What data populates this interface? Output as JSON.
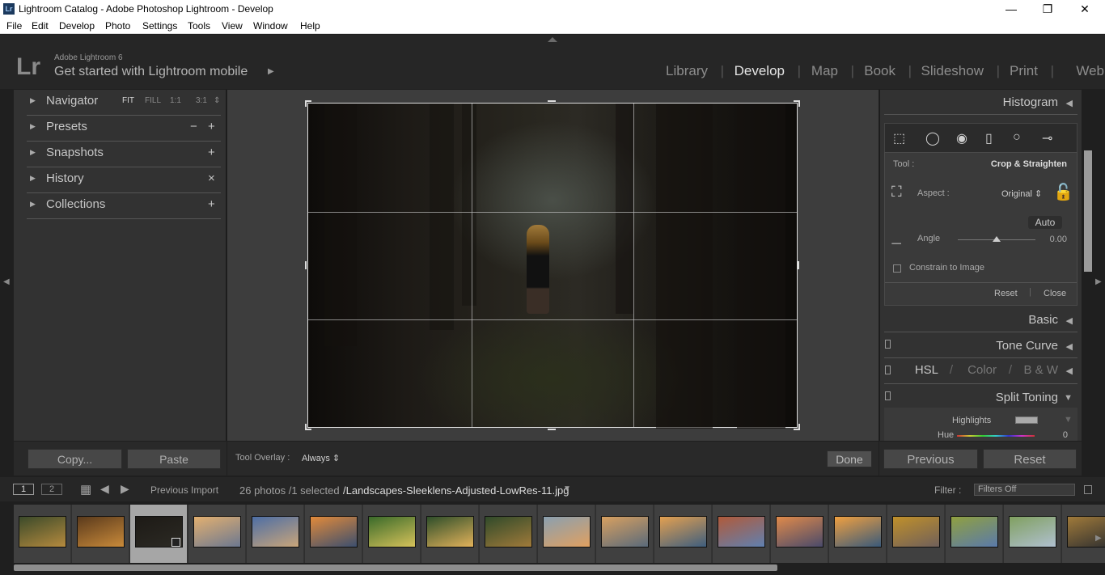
{
  "window": {
    "title": "Lightroom Catalog - Adobe Photoshop Lightroom - Develop",
    "app_icon": "Lr"
  },
  "menu": [
    "File",
    "Edit",
    "Develop",
    "Photo",
    "Settings",
    "Tools",
    "View",
    "Window",
    "Help"
  ],
  "identity": {
    "logo": "Lr",
    "small": "Adobe Lightroom 6",
    "big": "Get started with Lightroom mobile",
    "arrow": "▶"
  },
  "modules": [
    {
      "label": "Library",
      "active": false
    },
    {
      "label": "Develop",
      "active": true
    },
    {
      "label": "Map",
      "active": false
    },
    {
      "label": "Book",
      "active": false
    },
    {
      "label": "Slideshow",
      "active": false
    },
    {
      "label": "Print",
      "active": false
    },
    {
      "label": "Web",
      "active": false
    }
  ],
  "left_panel": {
    "navigator": {
      "label": "Navigator",
      "options": [
        "FIT",
        "FILL",
        "1:1",
        "3:1"
      ],
      "more": "⇕"
    },
    "presets": {
      "label": "Presets",
      "minus": "−",
      "plus": "+"
    },
    "snapshots": {
      "label": "Snapshots",
      "plus": "+"
    },
    "history": {
      "label": "History",
      "clear": "×"
    },
    "collections": {
      "label": "Collections",
      "plus": "+"
    }
  },
  "left_buttons": {
    "copy": "Copy...",
    "paste": "Paste"
  },
  "toolbar": {
    "overlay_label": "Tool Overlay :",
    "overlay_value": "Always ⇕",
    "done": "Done"
  },
  "right_panel": {
    "histogram": "Histogram",
    "tool_label": "Tool :",
    "tool_value": "Crop & Straighten",
    "aspect_label": "Aspect :",
    "aspect_value": "Original ⇕",
    "auto": "Auto",
    "angle_label": "Angle",
    "angle_value": "0.00",
    "constrain": "Constrain to Image",
    "reset": "Reset",
    "close": "Close",
    "basic": "Basic",
    "tone_curve": "Tone Curve",
    "hsl": "HSL",
    "color": "Color",
    "bw": "B & W",
    "split_toning": "Split Toning",
    "highlights": "Highlights",
    "hue": "Hue",
    "hue_value": "0",
    "collapsed_arrow": "◀",
    "expanded_arrow": "▼"
  },
  "right_buttons": {
    "previous": "Previous",
    "reset": "Reset"
  },
  "filmbar": {
    "page1": "1",
    "page2": "2",
    "source": "Previous Import",
    "count": "26 photos /1 selected",
    "filename": "/Landscapes-Sleeklens-Adjusted-LowRes-11.jpg",
    "filter_label": "Filter :",
    "filter_value": "Filters Off"
  },
  "thumbnails": [
    {
      "colors": [
        "#3b4a2a",
        "#b58a3e"
      ]
    },
    {
      "colors": [
        "#5a3a1c",
        "#c98a3a"
      ]
    },
    {
      "colors": [
        "#1d1a16",
        "#2c2a24"
      ]
    },
    {
      "colors": [
        "#e3b070",
        "#6c7890"
      ]
    },
    {
      "colors": [
        "#4d6ea5",
        "#c9a57a"
      ]
    },
    {
      "colors": [
        "#e28a3a",
        "#3c4f6e"
      ]
    },
    {
      "colors": [
        "#3a6a2a",
        "#d6c25a"
      ]
    },
    {
      "colors": [
        "#2e4e2a",
        "#e2b25a"
      ]
    },
    {
      "colors": [
        "#304a2a",
        "#a07a3a"
      ]
    },
    {
      "colors": [
        "#8aa0b0",
        "#e0a060"
      ]
    },
    {
      "colors": [
        "#d8a060",
        "#5a6a7a"
      ]
    },
    {
      "colors": [
        "#e3a050",
        "#3e5e7e"
      ]
    },
    {
      "colors": [
        "#b05a3a",
        "#6080b0"
      ]
    },
    {
      "colors": [
        "#e08a4a",
        "#4a4a6a"
      ]
    },
    {
      "colors": [
        "#f0a040",
        "#3a5a7a"
      ]
    },
    {
      "colors": [
        "#c0902a",
        "#70605a"
      ]
    },
    {
      "colors": [
        "#90a040",
        "#5a7aaa"
      ]
    },
    {
      "colors": [
        "#80a060",
        "#b0c0d0"
      ]
    },
    {
      "colors": [
        "#a07a3a",
        "#303030"
      ]
    }
  ]
}
